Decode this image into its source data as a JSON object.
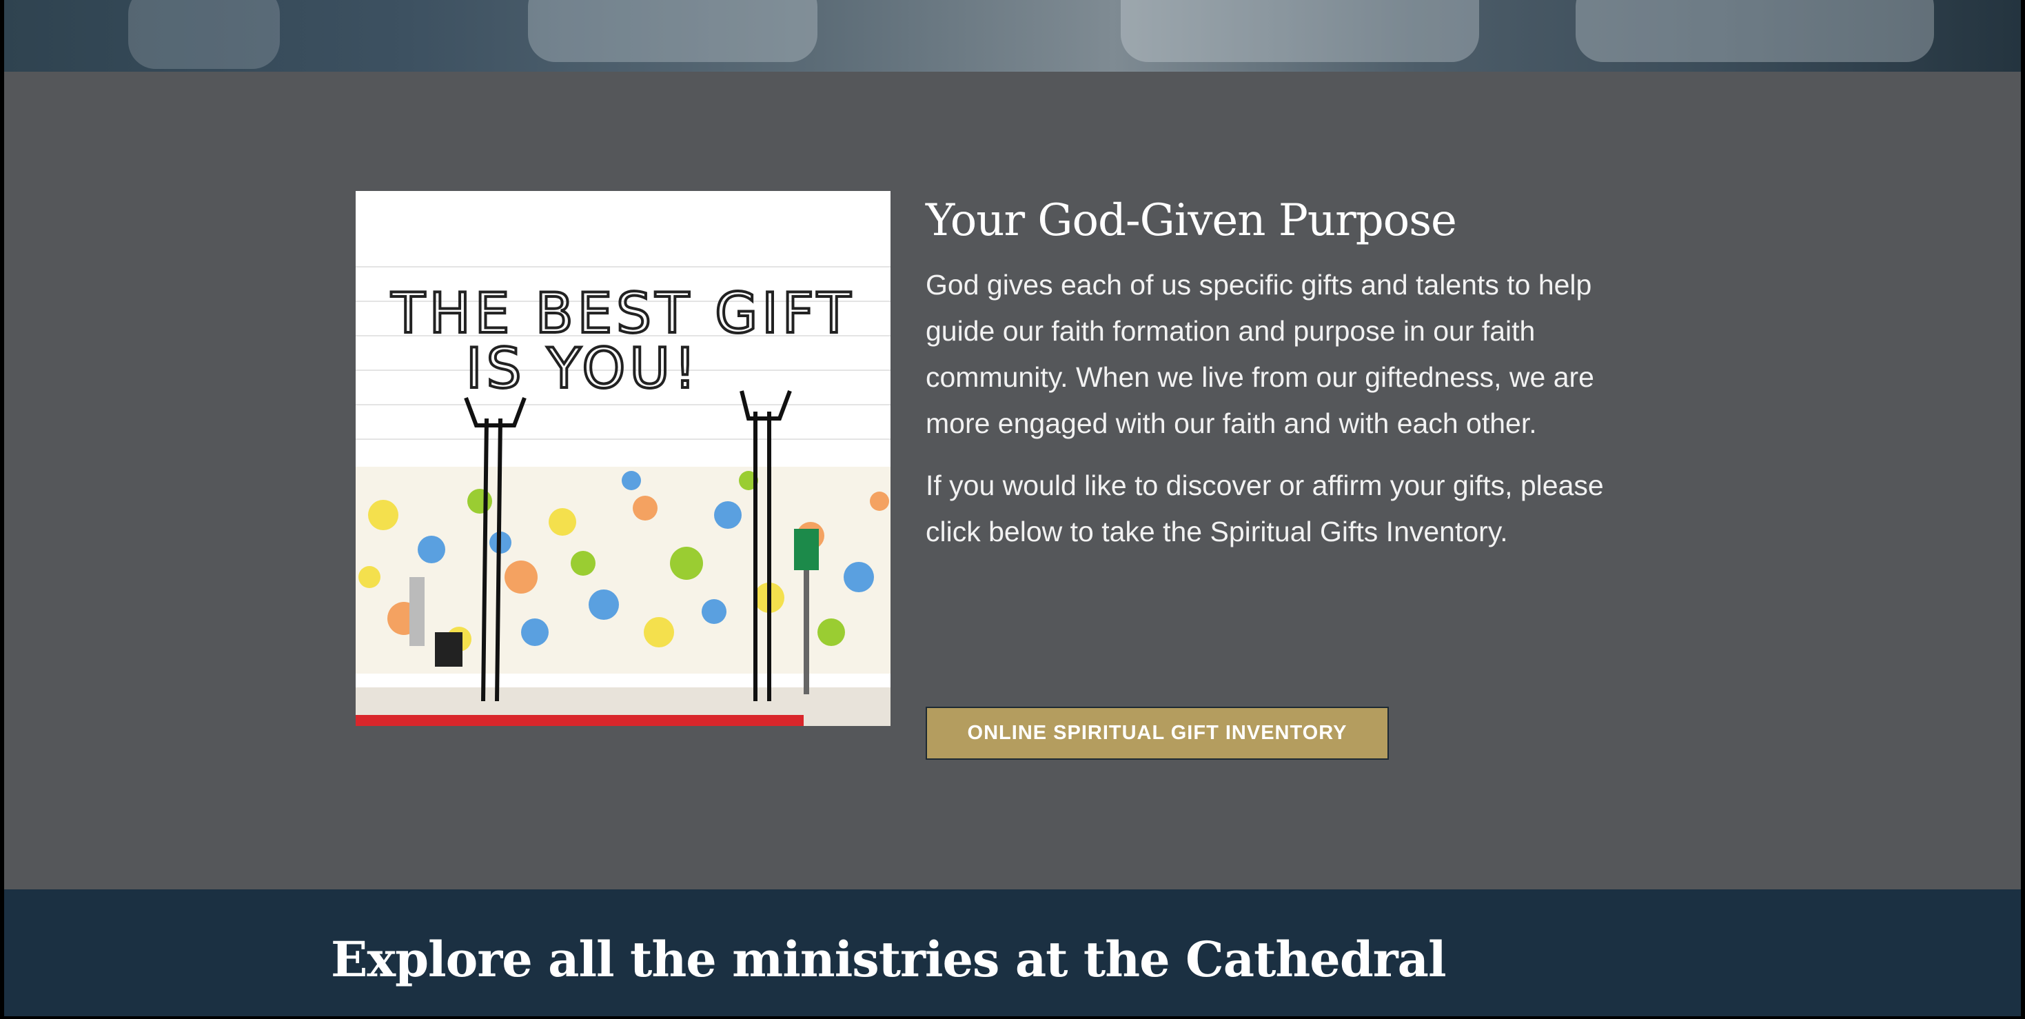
{
  "feature": {
    "image_alt": "Mural reading THE BEST GIFT IS YOU!",
    "title": "Your God-Given Purpose",
    "paragraphs": [
      "God gives each of us specific gifts and talents to help guide our faith formation and purpose in our faith community. When we live from our giftedness, we are more engaged with our faith and with each other.",
      "If you would like to discover or affirm your gifts, please click below to take the Spiritual Gifts Inventory."
    ],
    "button_label": "ONLINE SPIRITUAL GIFT INVENTORY"
  },
  "explore": {
    "heading": "Explore all the ministries at the Cathedral"
  },
  "colors": {
    "section_bg": "#55575a",
    "button_bg": "#b49d5f",
    "band_bg": "#1b3042"
  }
}
